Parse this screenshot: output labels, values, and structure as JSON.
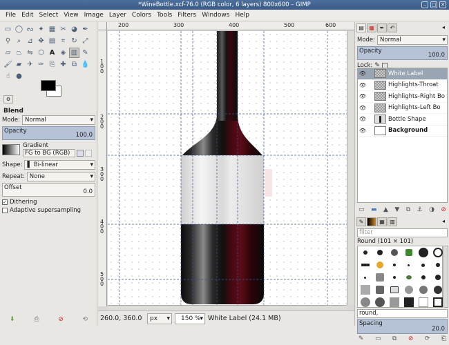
{
  "window": {
    "title": "*WineBottle.xcf-76.0 (RGB color, 6 layers) 800x600 – GIMP",
    "controls": [
      "–",
      "□",
      "✕"
    ]
  },
  "menu": [
    "File",
    "Edit",
    "Select",
    "View",
    "Image",
    "Layer",
    "Colors",
    "Tools",
    "Filters",
    "Windows",
    "Help"
  ],
  "toolbox": {
    "tools": [
      "rect-select",
      "ellipse-select",
      "free-select",
      "fuzzy-select",
      "color-select",
      "scissors",
      "foreground-select",
      "paths",
      "color-picker",
      "zoom",
      "measure",
      "move",
      "align",
      "crop",
      "rotate",
      "scale",
      "shear",
      "perspective",
      "flip",
      "cage",
      "text",
      "bucket-fill",
      "blend",
      "pencil",
      "paintbrush",
      "eraser",
      "airbrush",
      "ink",
      "clone",
      "heal",
      "perspective-clone",
      "blur",
      "smudge",
      "dodge-burn"
    ],
    "active_tool": "blend",
    "title": "Blend",
    "mode_label": "Mode:",
    "mode_value": "Normal",
    "opacity_label": "Opacity",
    "opacity_value": "100.0",
    "gradient_label": "Gradient",
    "gradient_value": "FG to BG (RGB)",
    "shape_label": "Shape:",
    "shape_value": "Bi-linear",
    "repeat_label": "Repeat:",
    "repeat_value": "None",
    "offset_label": "Offset",
    "offset_value": "0.0",
    "dithering_label": "Dithering",
    "dithering_checked": true,
    "adaptive_label": "Adaptive supersampling",
    "adaptive_checked": false,
    "bottom_icons": [
      "reset-icon",
      "save-icon",
      "delete-icon",
      "restore-icon"
    ]
  },
  "canvas": {
    "ruler_top": [
      "200",
      "300",
      "400",
      "500",
      "600"
    ],
    "ruler_left": [
      "1\n0\n0",
      "2\n0\n0",
      "3\n0\n0",
      "4\n0\n0",
      "5\n0\n0"
    ]
  },
  "status": {
    "coords": "260.0, 360.0",
    "unit": "px",
    "zoom": "150 %",
    "message": "White Label (24.1 MB)"
  },
  "layers": {
    "mode_label": "Mode:",
    "mode_value": "Normal",
    "opacity_label": "Opacity",
    "opacity_value": "100.0",
    "lock_label": "Lock:",
    "items": [
      {
        "name": "White Label",
        "selected": true,
        "thumb": "white",
        "bold": false
      },
      {
        "name": "Highlights-Throat",
        "selected": false,
        "thumb": "checker",
        "bold": false
      },
      {
        "name": "Highlights-Right Bo",
        "selected": false,
        "thumb": "checker",
        "bold": false
      },
      {
        "name": "Highlights-Left Bo",
        "selected": false,
        "thumb": "checker",
        "bold": false
      },
      {
        "name": "Bottle Shape",
        "selected": false,
        "thumb": "bottle",
        "bold": false
      },
      {
        "name": "Background",
        "selected": false,
        "thumb": "white",
        "bold": true
      }
    ]
  },
  "brushes": {
    "filter_placeholder": "filter",
    "current": "Round (101 × 101)",
    "tag": "round,",
    "spacing_label": "Spacing",
    "spacing_value": "20.0"
  }
}
